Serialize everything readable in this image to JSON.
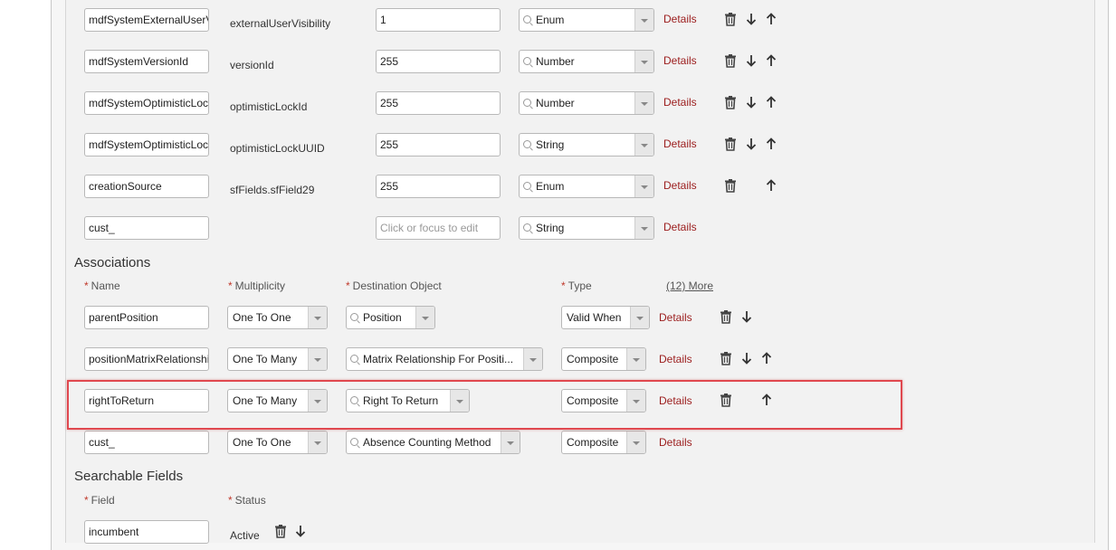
{
  "fields": [
    {
      "name": "mdfSystemExternalUserVisibility",
      "db_field": "externalUserVisibility",
      "max_length": "1",
      "type": "Enum",
      "details": "Details",
      "actions": [
        "delete",
        "down",
        "up"
      ]
    },
    {
      "name": "mdfSystemVersionId",
      "db_field": "versionId",
      "max_length": "255",
      "type": "Number",
      "details": "Details",
      "actions": [
        "delete",
        "down",
        "up"
      ]
    },
    {
      "name": "mdfSystemOptimisticLockId",
      "db_field": "optimisticLockId",
      "max_length": "255",
      "type": "Number",
      "details": "Details",
      "actions": [
        "delete",
        "down",
        "up"
      ]
    },
    {
      "name": "mdfSystemOptimisticLockUUID",
      "db_field": "optimisticLockUUID",
      "max_length": "255",
      "type": "String",
      "details": "Details",
      "actions": [
        "delete",
        "down",
        "up"
      ]
    },
    {
      "name": "creationSource",
      "db_field": "sfFields.sfField29",
      "max_length": "255",
      "type": "Enum",
      "details": "Details",
      "actions": [
        "delete",
        "up"
      ]
    },
    {
      "name": "cust_",
      "db_field": "",
      "max_length": "",
      "max_length_placeholder": "Click or focus to edit",
      "type": "String",
      "details": "Details",
      "actions": []
    }
  ],
  "associations": {
    "title": "Associations",
    "headers": {
      "name": "Name",
      "multiplicity": "Multiplicity",
      "destination": "Destination Object",
      "type": "Type",
      "more": "(12) More"
    },
    "required_marker": "*",
    "rows": [
      {
        "name": "parentPosition",
        "multiplicity": "One To One",
        "destination": "Position",
        "type": "Valid When",
        "details": "Details",
        "actions": [
          "delete",
          "down"
        ]
      },
      {
        "name": "positionMatrixRelationship",
        "multiplicity": "One To Many",
        "destination": "Matrix Relationship For Positi...",
        "type": "Composite",
        "details": "Details",
        "actions": [
          "delete",
          "down",
          "up"
        ]
      },
      {
        "name": "rightToReturn",
        "multiplicity": "One To Many",
        "destination": "Right To Return",
        "type": "Composite",
        "details": "Details",
        "actions": [
          "delete",
          "up"
        ],
        "highlighted": true
      },
      {
        "name": "cust_",
        "multiplicity": "One To One",
        "destination": "Absence Counting Method",
        "type": "Composite",
        "details": "Details",
        "actions": []
      }
    ]
  },
  "searchable_fields": {
    "title": "Searchable Fields",
    "headers": {
      "field": "Field",
      "status": "Status"
    },
    "rows": [
      {
        "field": "incumbent",
        "status": "Active",
        "actions": [
          "delete",
          "down"
        ]
      }
    ]
  },
  "colors": {
    "details_link": "#9b1c1c",
    "required_marker": "#c0392b",
    "highlight_border": "#e0484f",
    "panel_bg": "#f2f2f2"
  },
  "icons": {
    "delete": "trash-icon",
    "down": "arrow-down-icon",
    "up": "arrow-up-icon",
    "search": "search-icon",
    "dropdown": "chevron-down-icon"
  }
}
